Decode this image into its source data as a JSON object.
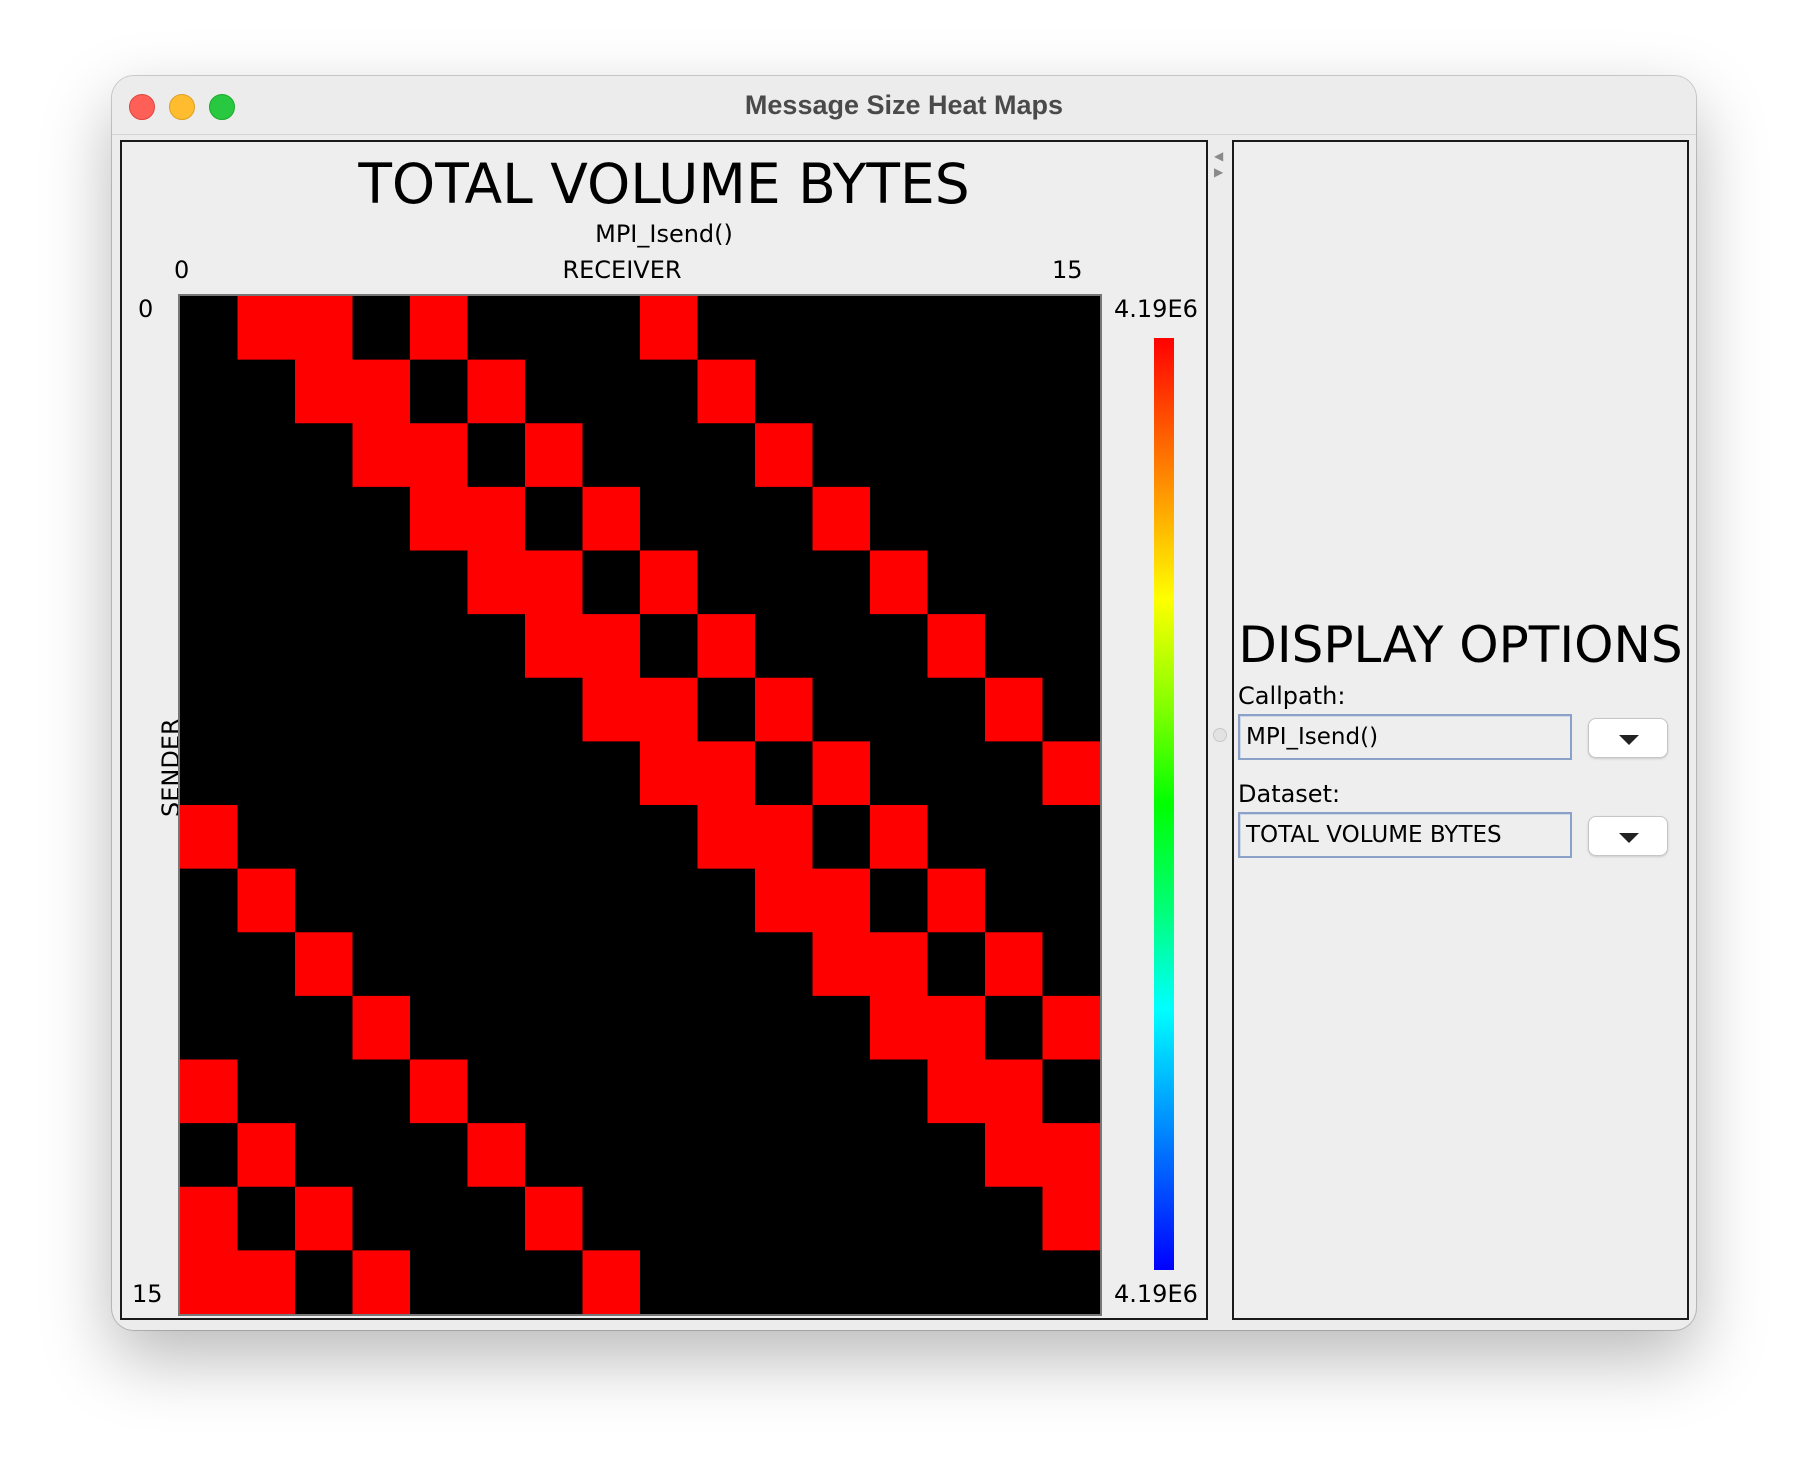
{
  "window": {
    "title": "Message Size Heat Maps"
  },
  "heatmap_panel": {
    "title": "TOTAL VOLUME BYTES",
    "subtitle": "MPI_Isend()",
    "receiver_label": "RECEIVER",
    "sender_label": "SENDER",
    "x_min": "0",
    "x_max": "15",
    "y_min": "0",
    "y_max": "15",
    "scale_max": "4.19E6",
    "scale_min": "4.19E6"
  },
  "options_panel": {
    "title": "DISPLAY OPTIONS",
    "callpath_label": "Callpath:",
    "callpath_value": "MPI_Isend()",
    "dataset_label": "Dataset:",
    "dataset_value": "TOTAL VOLUME BYTES"
  },
  "chart_data": {
    "type": "heatmap",
    "title": "TOTAL VOLUME BYTES",
    "subtitle": "MPI_Isend()",
    "xlabel": "RECEIVER",
    "ylabel": "SENDER",
    "x_range": [
      0,
      15
    ],
    "y_range": [
      0,
      15
    ],
    "colorscale_range": [
      "4.19E6",
      "4.19E6"
    ],
    "colors": {
      "filled": "#ff0000",
      "empty": "#000000"
    },
    "matrix": [
      [
        0,
        1,
        1,
        0,
        1,
        0,
        0,
        0,
        1,
        0,
        0,
        0,
        0,
        0,
        0,
        0
      ],
      [
        0,
        0,
        1,
        1,
        0,
        1,
        0,
        0,
        0,
        1,
        0,
        0,
        0,
        0,
        0,
        0
      ],
      [
        0,
        0,
        0,
        1,
        1,
        0,
        1,
        0,
        0,
        0,
        1,
        0,
        0,
        0,
        0,
        0
      ],
      [
        0,
        0,
        0,
        0,
        1,
        1,
        0,
        1,
        0,
        0,
        0,
        1,
        0,
        0,
        0,
        0
      ],
      [
        0,
        0,
        0,
        0,
        0,
        1,
        1,
        0,
        1,
        0,
        0,
        0,
        1,
        0,
        0,
        0
      ],
      [
        0,
        0,
        0,
        0,
        0,
        0,
        1,
        1,
        0,
        1,
        0,
        0,
        0,
        1,
        0,
        0
      ],
      [
        0,
        0,
        0,
        0,
        0,
        0,
        0,
        1,
        1,
        0,
        1,
        0,
        0,
        0,
        1,
        0
      ],
      [
        0,
        0,
        0,
        0,
        0,
        0,
        0,
        0,
        1,
        1,
        0,
        1,
        0,
        0,
        0,
        1
      ],
      [
        1,
        0,
        0,
        0,
        0,
        0,
        0,
        0,
        0,
        1,
        1,
        0,
        1,
        0,
        0,
        0
      ],
      [
        0,
        1,
        0,
        0,
        0,
        0,
        0,
        0,
        0,
        0,
        1,
        1,
        0,
        1,
        0,
        0
      ],
      [
        0,
        0,
        1,
        0,
        0,
        0,
        0,
        0,
        0,
        0,
        0,
        1,
        1,
        0,
        1,
        0
      ],
      [
        0,
        0,
        0,
        1,
        0,
        0,
        0,
        0,
        0,
        0,
        0,
        0,
        1,
        1,
        0,
        1
      ],
      [
        1,
        0,
        0,
        0,
        1,
        0,
        0,
        0,
        0,
        0,
        0,
        0,
        0,
        1,
        1,
        0
      ],
      [
        0,
        1,
        0,
        0,
        0,
        1,
        0,
        0,
        0,
        0,
        0,
        0,
        0,
        0,
        1,
        1
      ],
      [
        1,
        0,
        1,
        0,
        0,
        0,
        1,
        0,
        0,
        0,
        0,
        0,
        0,
        0,
        0,
        1
      ],
      [
        1,
        1,
        0,
        1,
        0,
        0,
        0,
        1,
        0,
        0,
        0,
        0,
        0,
        0,
        0,
        0
      ]
    ]
  }
}
